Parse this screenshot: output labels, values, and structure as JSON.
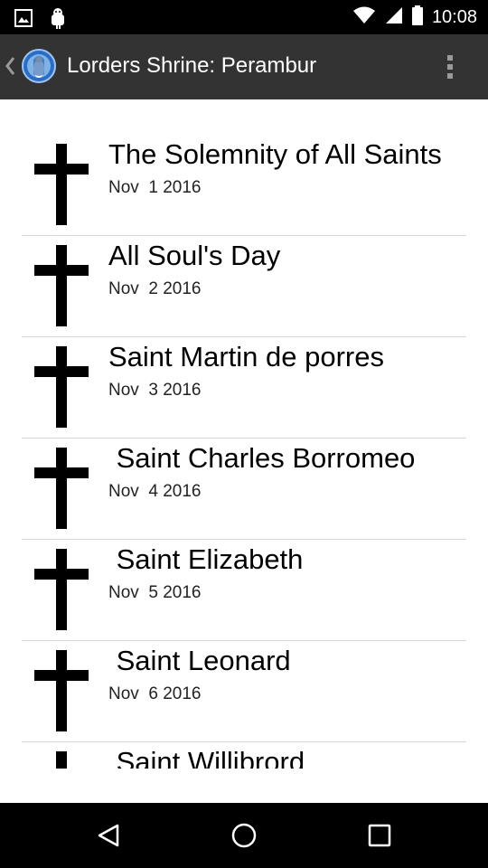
{
  "status_bar": {
    "time": "10:08",
    "icons": [
      "image-notification-icon",
      "android-notification-icon",
      "wifi-icon",
      "signal-icon",
      "battery-icon"
    ]
  },
  "app_bar": {
    "title": "Lorders Shrine: Perambur",
    "icons": [
      "back-chevron-icon",
      "shrine-logo-icon",
      "overflow-menu-icon"
    ],
    "background": "#333333"
  },
  "feasts": [
    {
      "title": "The Solemnity of All Saints",
      "date": "Nov  1 2016"
    },
    {
      "title": "All Soul's Day",
      "date": "Nov  2 2016"
    },
    {
      "title": "Saint Martin de porres",
      "date": "Nov  3 2016"
    },
    {
      "title": " Saint Charles Borromeo",
      "date": "Nov  4 2016"
    },
    {
      "title": " Saint Elizabeth",
      "date": "Nov  5 2016"
    },
    {
      "title": " Saint Leonard",
      "date": "Nov  6 2016"
    },
    {
      "title": " Saint Willibrord",
      "date": ""
    }
  ],
  "nav_bar": {
    "icons": [
      "back-triangle-icon",
      "home-circle-icon",
      "recents-square-icon"
    ]
  }
}
